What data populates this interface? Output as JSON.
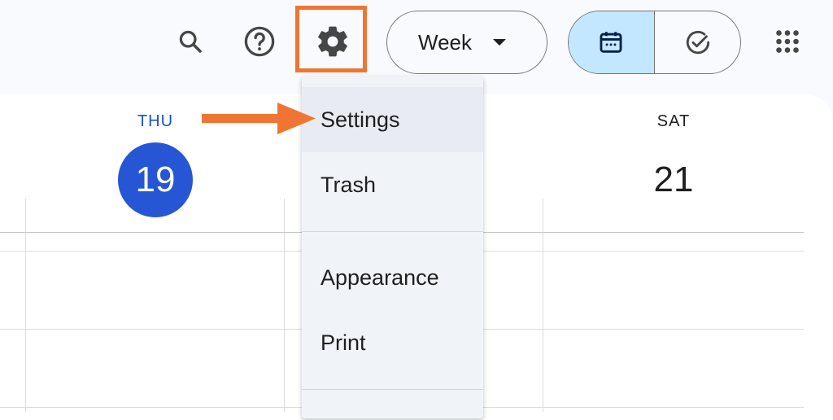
{
  "header": {
    "search_icon": "search-icon",
    "help_icon": "help-icon",
    "settings_icon": "gear-icon",
    "view_select": {
      "selected": "Week"
    },
    "mode_toggle": {
      "calendar_icon": "calendar-icon",
      "tasks_icon": "check-circle-icon",
      "active": "calendar"
    },
    "apps_icon": "apps-grid-icon"
  },
  "days": [
    {
      "name": "THU",
      "number": "19",
      "today": true
    },
    {
      "name": "SAT",
      "number": "21",
      "today": false
    }
  ],
  "settings_menu": {
    "items": [
      {
        "label": "Settings"
      },
      {
        "label": "Trash"
      },
      {
        "label": "Appearance"
      },
      {
        "label": "Print"
      }
    ]
  },
  "annotation": {
    "highlight_color": "#f07533",
    "arrow_color": "#f07533"
  },
  "colors": {
    "accent": "#2756d5",
    "toggle_active": "#c2e7ff",
    "menu_bg": "#f0f4f9"
  }
}
